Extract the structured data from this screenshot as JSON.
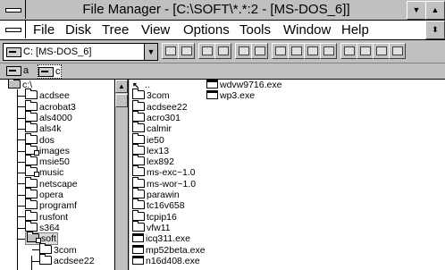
{
  "window": {
    "title": "File Manager - [C:\\SOFT\\*.*:2 - [MS-DOS_6]]"
  },
  "menus": [
    "File",
    "Disk",
    "Tree",
    "View",
    "Options",
    "Tools",
    "Window",
    "Help"
  ],
  "toolbar": {
    "drive_value": "C: [MS-DOS_6]"
  },
  "drives": [
    {
      "label": "a"
    },
    {
      "label": "c"
    }
  ],
  "tree": {
    "root": "c:\\",
    "items": [
      "acdsee",
      "acrobat3",
      "als4000",
      "als4k",
      "dos",
      "images",
      "msie50",
      "music",
      "netscape",
      "opera",
      "programf",
      "rusfont",
      "s364",
      "soft"
    ],
    "soft_children": [
      "3com",
      "acdsee22"
    ]
  },
  "files": {
    "col1": [
      "..",
      "3com",
      "acdsee22",
      "acro301",
      "calmir",
      "ie50",
      "lex13",
      "lex892",
      "ms-exc~1.0",
      "ms-wor~1.0",
      "parawin",
      "tc16v658",
      "tcpip16",
      "vfw11",
      "icq311.exe",
      "mp52beta.exe",
      "n16d408.exe"
    ],
    "col2": [
      "wdvw9716.exe",
      "wp3.exe"
    ]
  }
}
